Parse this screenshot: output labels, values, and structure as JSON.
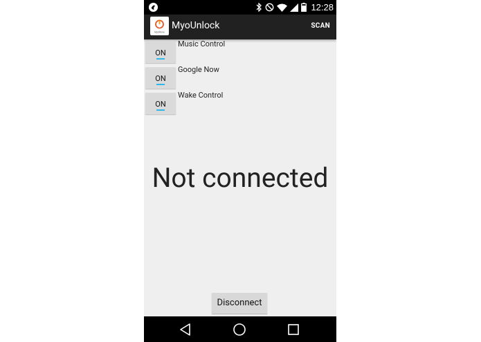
{
  "status_bar": {
    "time": "12:28",
    "icons": [
      "bluetooth-icon",
      "do-not-disturb-icon",
      "wifi-icon",
      "cellular-signal-icon",
      "battery-icon"
    ]
  },
  "action_bar": {
    "title": "MyoUnlock",
    "action_label": "SCAN",
    "app_icon_text": "MyoMove"
  },
  "toggles": [
    {
      "state": "ON",
      "label": "Music Control"
    },
    {
      "state": "ON",
      "label": "Google Now"
    },
    {
      "state": "ON",
      "label": "Wake Control"
    }
  ],
  "status_message": "Not connected",
  "disconnect_label": "Disconnect",
  "colors": {
    "action_bar_bg": "#212121",
    "background": "#efefef",
    "toggle_indicator": "#33b5e5"
  }
}
